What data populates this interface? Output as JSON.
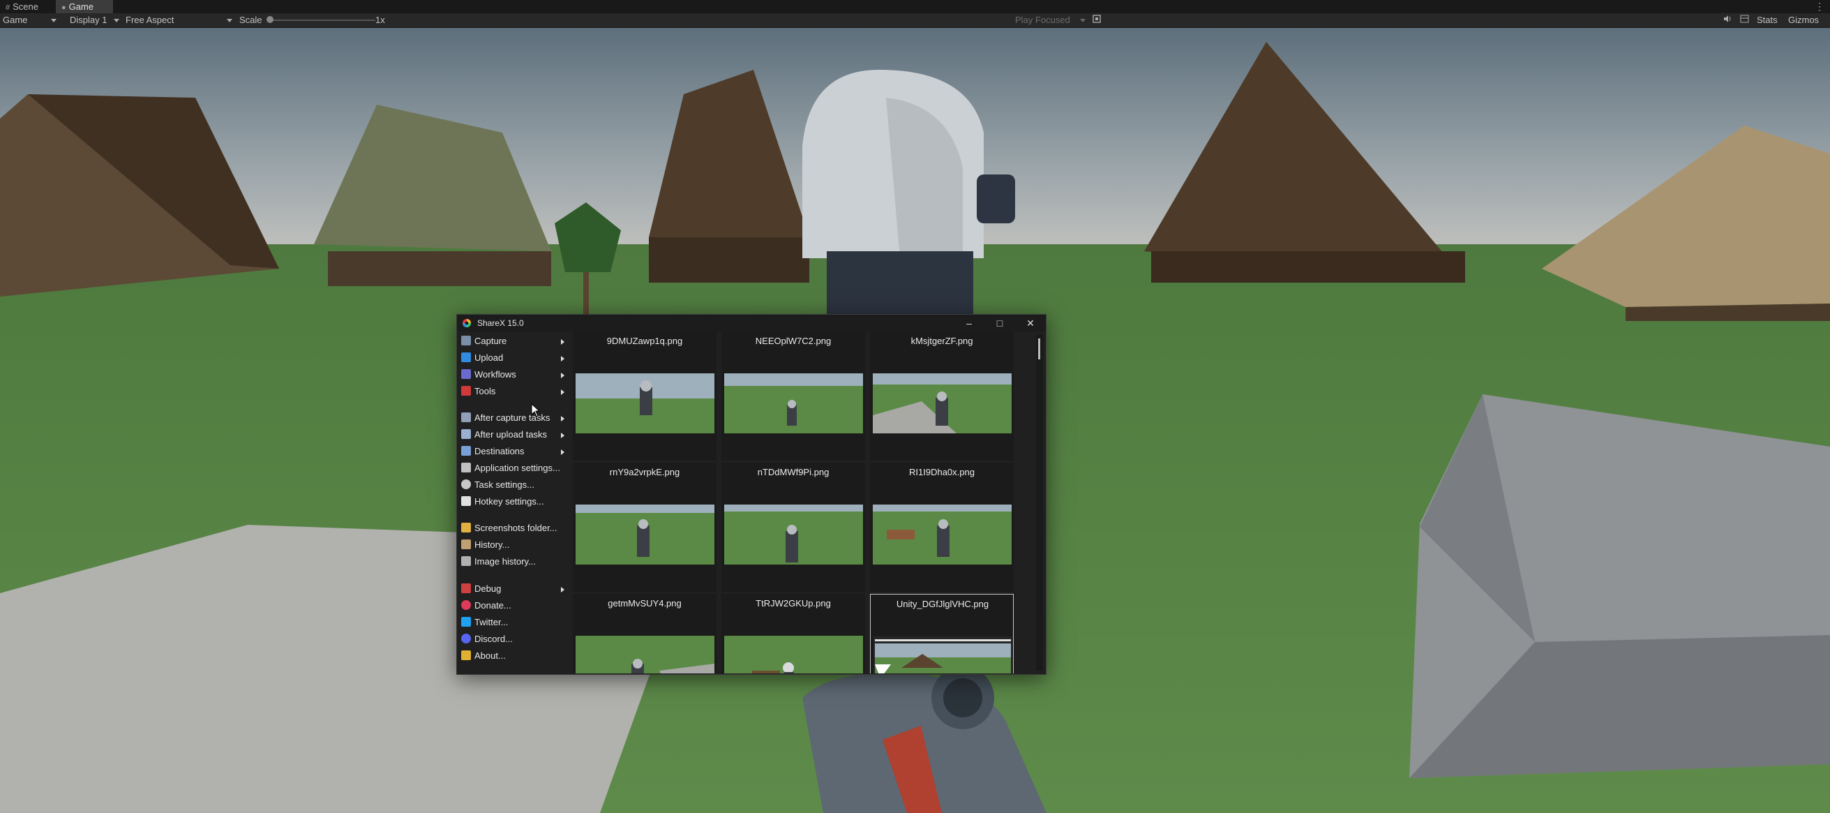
{
  "tabs": [
    {
      "label": "Scene",
      "icon": "grid-icon"
    },
    {
      "label": "Game",
      "icon": "gamepad-icon",
      "active": true
    }
  ],
  "toolbar": {
    "view_mode": "Game",
    "display": "Display 1",
    "aspect": "Free Aspect",
    "scale_label": "Scale",
    "scale_value": "1x",
    "scale_level": 0,
    "play_mode": "Play Focused",
    "stats_label": "Stats",
    "gizmos_label": "Gizmos"
  },
  "sharex": {
    "title": "ShareX 15.0",
    "menu": [
      {
        "label": "Capture",
        "icon": "camera-icon",
        "submenu": true,
        "color": "#7a8ea8"
      },
      {
        "label": "Upload",
        "icon": "upload-arrow-icon",
        "submenu": true,
        "color": "#2f8ce0"
      },
      {
        "label": "Workflows",
        "icon": "workflows-grid-icon",
        "submenu": true,
        "color": "#6a6ad0"
      },
      {
        "label": "Tools",
        "icon": "toolbox-icon",
        "submenu": true,
        "color": "#d23a3a"
      },
      {
        "label": "After capture tasks",
        "icon": "after-capture-icon",
        "submenu": true,
        "color": "#8fa0b8"
      },
      {
        "label": "After upload tasks",
        "icon": "cloud-upload-icon",
        "submenu": true,
        "color": "#9ab0d0"
      },
      {
        "label": "Destinations",
        "icon": "destinations-icon",
        "submenu": true,
        "color": "#7aa0d8"
      },
      {
        "label": "Application settings...",
        "icon": "wrench-icon",
        "submenu": false,
        "color": "#c0c0c0"
      },
      {
        "label": "Task settings...",
        "icon": "gear-icon",
        "submenu": false,
        "color": "#c8c8c8"
      },
      {
        "label": "Hotkey settings...",
        "icon": "keyboard-icon",
        "submenu": false,
        "color": "#e0e0e0"
      },
      {
        "label": "Screenshots folder...",
        "icon": "folder-icon",
        "submenu": false,
        "color": "#e0b040"
      },
      {
        "label": "History...",
        "icon": "history-icon",
        "submenu": false,
        "color": "#c0a070"
      },
      {
        "label": "Image history...",
        "icon": "image-history-icon",
        "submenu": false,
        "color": "#b0b0b0"
      },
      {
        "label": "Debug",
        "icon": "bug-icon",
        "submenu": true,
        "color": "#d04040"
      },
      {
        "label": "Donate...",
        "icon": "heart-icon",
        "submenu": false,
        "color": "#e03a5a"
      },
      {
        "label": "Twitter...",
        "icon": "twitter-icon",
        "submenu": false,
        "color": "#1da1f2"
      },
      {
        "label": "Discord...",
        "icon": "discord-icon",
        "submenu": false,
        "color": "#5865f2"
      },
      {
        "label": "About...",
        "icon": "crown-icon",
        "submenu": false,
        "color": "#e0b030"
      }
    ],
    "thumbnails": [
      {
        "filename": "9DMUZawp1q.png"
      },
      {
        "filename": "NEEOplW7C2.png"
      },
      {
        "filename": "kMsjtgerZF.png"
      },
      {
        "filename": "rnY9a2vrpkE.png"
      },
      {
        "filename": "nTDdMWf9Pi.png"
      },
      {
        "filename": "RI1I9Dha0x.png"
      },
      {
        "filename": "getmMvSUY4.png"
      },
      {
        "filename": "TtRJW2GKUp.png"
      },
      {
        "filename": "Unity_DGfJlglVHC.png",
        "selected": true
      }
    ]
  }
}
